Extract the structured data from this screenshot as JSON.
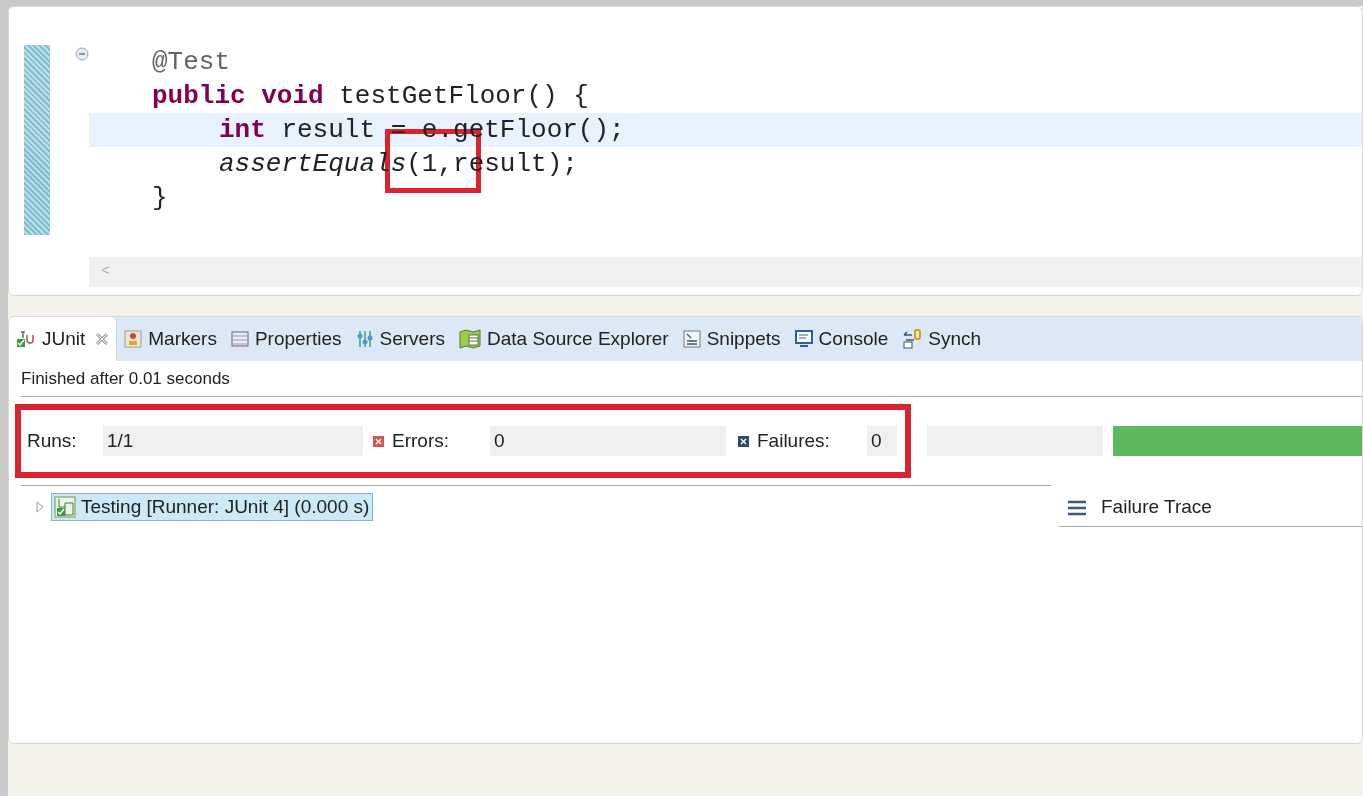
{
  "editor": {
    "lines": [
      {
        "current": false,
        "tokens": [
          {
            "kind": "annotation",
            "text": "@Test"
          }
        ]
      },
      {
        "current": false,
        "tokens": [
          {
            "kind": "keyword",
            "text": "public void"
          },
          {
            "kind": "plain",
            "text": " testGetFloor() {"
          }
        ]
      },
      {
        "current": true,
        "indented": true,
        "tokens": [
          {
            "kind": "keyword",
            "text": "int"
          },
          {
            "kind": "plain",
            "text": " result = e.getFloor();"
          }
        ]
      },
      {
        "current": false,
        "indented": true,
        "tokens": [
          {
            "kind": "static",
            "text": "assertEquals"
          },
          {
            "kind": "plain",
            "text": "(1,result);"
          }
        ]
      },
      {
        "current": false,
        "tokens": [
          {
            "kind": "plain",
            "text": "}"
          }
        ]
      }
    ],
    "scroll_arrow": "<"
  },
  "view_tabs": [
    {
      "label": "JUnit",
      "selected": true,
      "closable": true
    },
    {
      "label": "Markers",
      "selected": false,
      "closable": false
    },
    {
      "label": "Properties",
      "selected": false,
      "closable": false
    },
    {
      "label": "Servers",
      "selected": false,
      "closable": false
    },
    {
      "label": "Data Source Explorer",
      "selected": false,
      "closable": false
    },
    {
      "label": "Snippets",
      "selected": false,
      "closable": false
    },
    {
      "label": "Console",
      "selected": false,
      "closable": false
    },
    {
      "label": "Synch",
      "selected": false,
      "closable": false
    }
  ],
  "junit": {
    "status": "Finished after 0.01 seconds",
    "counters": [
      {
        "label": "Runs:",
        "value": "1/1",
        "kind": "runs"
      },
      {
        "label": "Errors:",
        "value": "0",
        "kind": "errors"
      },
      {
        "label": "Failures:",
        "value": "0",
        "kind": "failures"
      }
    ],
    "progress": {
      "level": 1
    },
    "tree": [
      {
        "label": "Testing [Runner: JUnit 4] (0.000 s)",
        "expanded": false,
        "selected": true
      }
    ],
    "failure_trace": {
      "title": "Failure Trace"
    }
  }
}
